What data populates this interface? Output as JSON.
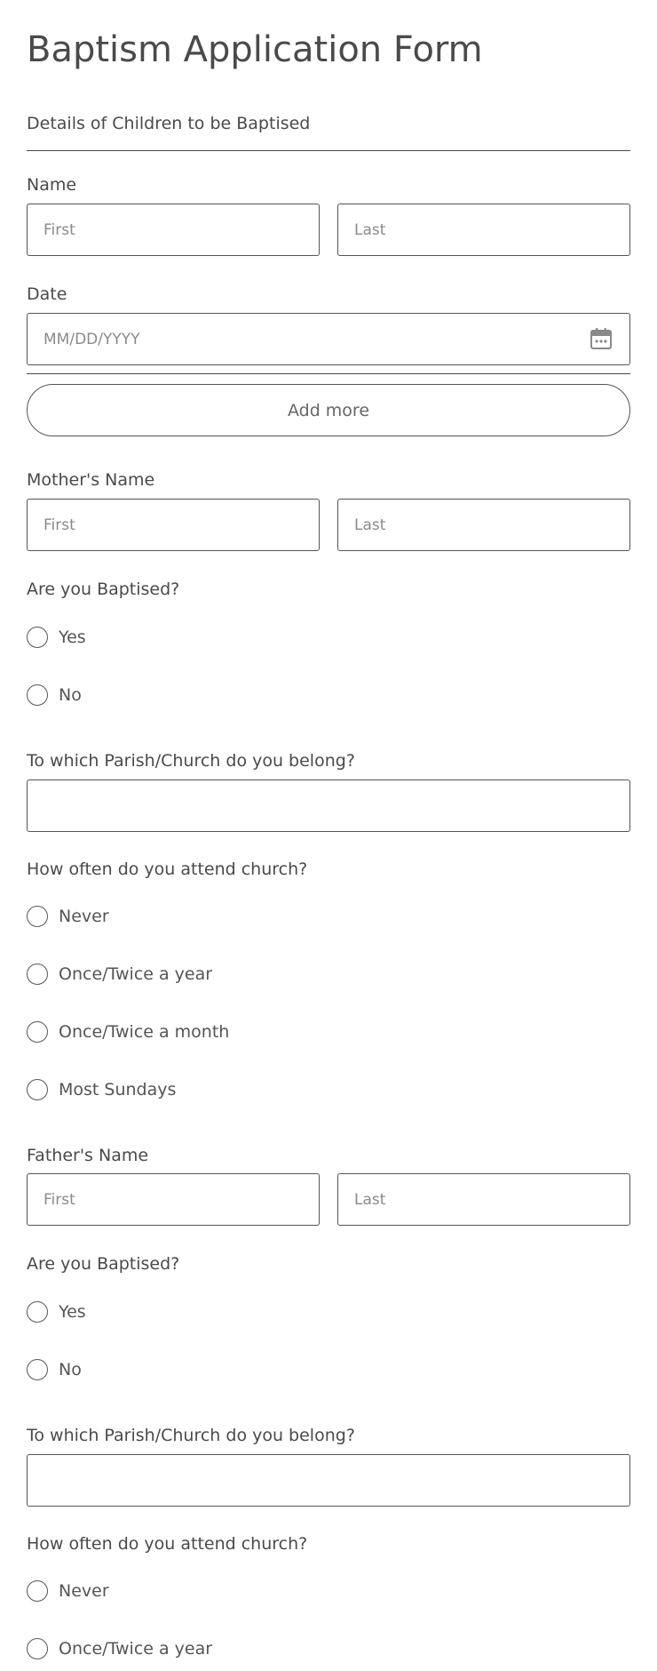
{
  "form": {
    "title": "Baptism Application Form",
    "section_label": "Details of Children to be Baptised",
    "child": {
      "name_label": "Name",
      "first_placeholder": "First",
      "last_placeholder": "Last",
      "date_label": "Date",
      "date_placeholder": "MM/DD/YYYY",
      "add_more_label": "Add more"
    },
    "mother": {
      "name_label": "Mother's Name",
      "first_placeholder": "First",
      "last_placeholder": "Last",
      "baptised_question": "Are you Baptised?",
      "baptised_options": [
        "Yes",
        "No"
      ],
      "parish_question": "To which Parish/Church do you belong?",
      "parish_value": "",
      "attend_question": "How often do you attend church?",
      "attend_options": [
        "Never",
        "Once/Twice a year",
        "Once/Twice a month",
        "Most Sundays"
      ]
    },
    "father": {
      "name_label": "Father's Name",
      "first_placeholder": "First",
      "last_placeholder": "Last",
      "baptised_question": "Are you Baptised?",
      "baptised_options": [
        "Yes",
        "No"
      ],
      "parish_question": "To which Parish/Church do you belong?",
      "parish_value": "",
      "attend_question": "How often do you attend church?",
      "attend_options": [
        "Never",
        "Once/Twice a year"
      ]
    }
  },
  "icons": {
    "date_picker": "calendar-icon"
  },
  "colors": {
    "text": "#4a4a4a",
    "border": "#555555",
    "placeholder": "#8a8a8a",
    "background": "#ffffff"
  }
}
